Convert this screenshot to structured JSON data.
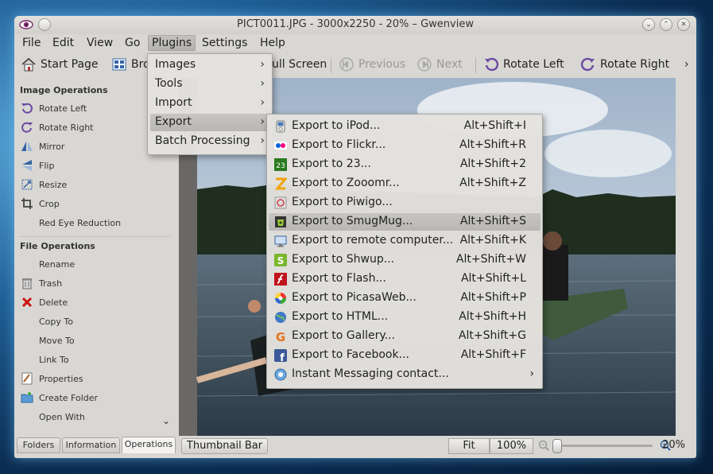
{
  "window": {
    "title": "PICT0011.JPG - 3000x2250 - 20% – Gwenview"
  },
  "menubar": {
    "items": [
      "File",
      "Edit",
      "View",
      "Go",
      "Plugins",
      "Settings",
      "Help"
    ],
    "active": "Plugins"
  },
  "toolbar": {
    "start_page": "Start Page",
    "browse": "Bro",
    "full_screen": "ull Screen",
    "previous": "Previous",
    "next": "Next",
    "rotate_left": "Rotate Left",
    "rotate_right": "Rotate Right",
    "overflow": "›"
  },
  "sidebar": {
    "image_ops_title": "Image Operations",
    "image_ops": [
      "Rotate Left",
      "Rotate Right",
      "Mirror",
      "Flip",
      "Resize",
      "Crop",
      "Red Eye Reduction"
    ],
    "file_ops_title": "File Operations",
    "file_ops": [
      "Rename",
      "Trash",
      "Delete",
      "Copy To",
      "Move To",
      "Link To",
      "Properties",
      "Create Folder",
      "Open With"
    ],
    "scroll_more": "⌄",
    "tabs": [
      "Folders",
      "Information",
      "Operations"
    ],
    "active_tab": "Operations"
  },
  "plugins_menu": {
    "items": [
      {
        "label": "Images",
        "arrow": "›"
      },
      {
        "label": "Tools",
        "arrow": "›"
      },
      {
        "label": "Import",
        "arrow": "›"
      },
      {
        "label": "Export",
        "arrow": "›"
      },
      {
        "label": "Batch Processing",
        "arrow": "›"
      }
    ],
    "highlighted": "Export"
  },
  "export_menu": {
    "items": [
      {
        "label": "Export to iPod...",
        "shortcut": "Alt+Shift+I",
        "icon": "ipod-icon"
      },
      {
        "label": "Export to Flickr...",
        "shortcut": "Alt+Shift+R",
        "icon": "flickr-icon"
      },
      {
        "label": "Export to 23...",
        "shortcut": "Alt+Shift+2",
        "icon": "23-icon"
      },
      {
        "label": "Export to Zooomr...",
        "shortcut": "Alt+Shift+Z",
        "icon": "zooomr-icon"
      },
      {
        "label": "Export to Piwigo...",
        "shortcut": "",
        "icon": "piwigo-icon"
      },
      {
        "label": "Export to SmugMug...",
        "shortcut": "Alt+Shift+S",
        "icon": "smugmug-icon"
      },
      {
        "label": "Export to remote computer...",
        "shortcut": "Alt+Shift+K",
        "icon": "remote-computer-icon"
      },
      {
        "label": "Export to Shwup...",
        "shortcut": "Alt+Shift+W",
        "icon": "shwup-icon"
      },
      {
        "label": "Export to Flash...",
        "shortcut": "Alt+Shift+L",
        "icon": "flash-icon"
      },
      {
        "label": "Export to PicasaWeb...",
        "shortcut": "Alt+Shift+P",
        "icon": "picasaweb-icon"
      },
      {
        "label": "Export to HTML...",
        "shortcut": "Alt+Shift+H",
        "icon": "html-icon"
      },
      {
        "label": "Export to Gallery...",
        "shortcut": "Alt+Shift+G",
        "icon": "gallery-icon"
      },
      {
        "label": "Export to Facebook...",
        "shortcut": "Alt+Shift+F",
        "icon": "facebook-icon"
      },
      {
        "label": "Instant Messaging contact...",
        "shortcut": "",
        "icon": "im-contact-icon",
        "arrow": "›"
      }
    ],
    "highlighted": "Export to SmugMug..."
  },
  "statusbar": {
    "thumbnail_bar": "Thumbnail Bar",
    "fit": "Fit",
    "zoom_100": "100%",
    "zoom_percent": "20%",
    "zoom_level": 0.2
  },
  "colors": {
    "menu_highlight": "#bfbdb9",
    "window_bg": "#d9d7d3",
    "desktop": "#1f5f95"
  }
}
